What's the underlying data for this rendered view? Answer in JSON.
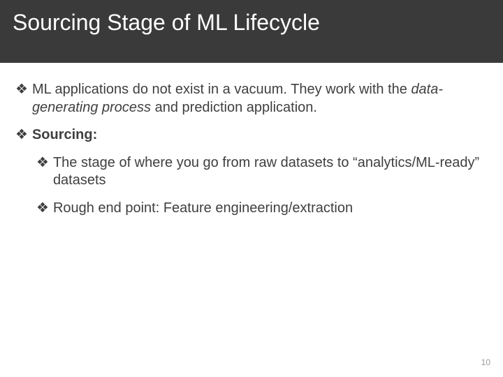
{
  "title": "Sourcing Stage of ML Lifecycle",
  "bullets": {
    "b1_pre": "ML applications do not exist in a vacuum. They work with the ",
    "b1_em": "data-generating process",
    "b1_post": " and prediction application.",
    "b2_label": "Sourcing:",
    "b2a": "The stage of where you go from raw datasets to “analytics/ML-ready” datasets",
    "b2b": "Rough end point: Feature engineering/extraction"
  },
  "bullet_glyph": "❖",
  "page_number": "10"
}
